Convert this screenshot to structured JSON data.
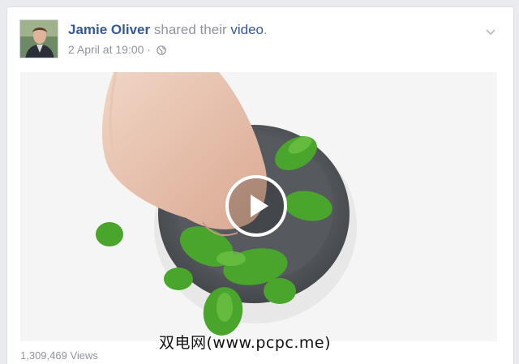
{
  "post": {
    "author": "Jamie Oliver",
    "action_pre": "shared their",
    "action_link": "video",
    "action_suffix": ".",
    "date": "2 April at 19:00",
    "separator": "·",
    "privacy_icon": "globe-icon",
    "menu_icon": "chevron-down-icon"
  },
  "video": {
    "play_icon": "play-icon",
    "views": "1,309,469 Views"
  },
  "watermark": "双电网(www.pcpc.me)",
  "colors": {
    "link": "#365899",
    "meta": "#90949c",
    "page_bg": "#e9ebee"
  }
}
